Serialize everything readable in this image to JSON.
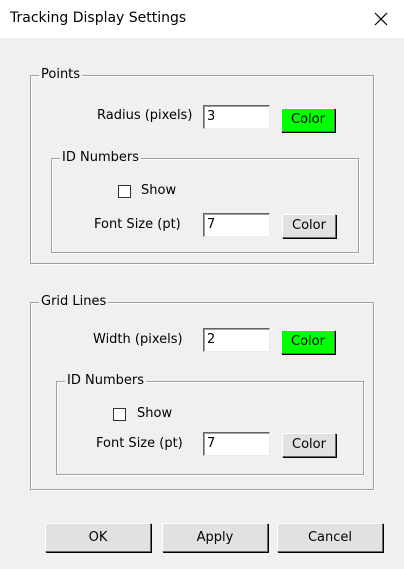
{
  "window": {
    "title": "Tracking Display Settings"
  },
  "points": {
    "legend": "Points",
    "radius_label": "Radius (pixels)",
    "radius_value": "3",
    "color_label": "Color",
    "color_swatch": "#00ff00",
    "id_numbers": {
      "legend": "ID Numbers",
      "show_label": "Show",
      "show_checked": false,
      "font_size_label": "Font Size (pt)",
      "font_size_value": "7",
      "color_label": "Color"
    }
  },
  "grid_lines": {
    "legend": "Grid Lines",
    "width_label": "Width (pixels)",
    "width_value": "2",
    "color_label": "Color",
    "color_swatch": "#00ff00",
    "id_numbers": {
      "legend": "ID Numbers",
      "show_label": "Show",
      "show_checked": false,
      "font_size_label": "Font Size (pt)",
      "font_size_value": "7",
      "color_label": "Color"
    }
  },
  "buttons": {
    "ok": "OK",
    "apply": "Apply",
    "cancel": "Cancel"
  },
  "icons": {
    "close": "close-icon"
  }
}
